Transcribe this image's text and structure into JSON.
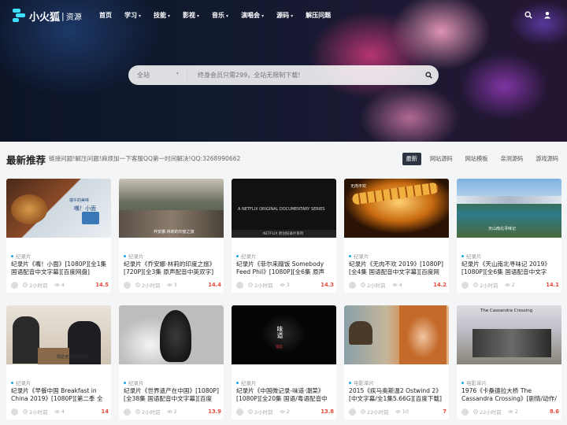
{
  "logo": {
    "name": "小火狐",
    "separator": "|",
    "sub": "资源"
  },
  "nav": [
    {
      "label": "首页",
      "dropdown": false
    },
    {
      "label": "学习",
      "dropdown": true
    },
    {
      "label": "技能",
      "dropdown": true
    },
    {
      "label": "影视",
      "dropdown": true
    },
    {
      "label": "音乐",
      "dropdown": true
    },
    {
      "label": "演唱会",
      "dropdown": true
    },
    {
      "label": "源码",
      "dropdown": true
    },
    {
      "label": "解压问题",
      "dropdown": false
    }
  ],
  "search": {
    "category": "全站",
    "placeholder": "终身会员只需299，全站无限制下载!"
  },
  "section": {
    "title": "最新推荐",
    "desc": "链接问题!解压问题!麻烦加一下客服QQ第一时间解决!QQ:3268990662"
  },
  "tabs": [
    "最新",
    "网站源码",
    "网站模板",
    "亲测源码",
    "游戏源码"
  ],
  "colors": {
    "accent": "#2c3442",
    "score": "#e84a3c",
    "cat_dot": "#1aa8e0"
  },
  "cards": [
    {
      "cat": "纪录片",
      "title": "纪录片《嘴！小面》[1080P][全1集 国语配音中文字幕][百度网盘]",
      "time": "2小时前",
      "views": "4",
      "score": "14.5",
      "overlay": [
        "端午的美味",
        "嘴！小面"
      ]
    },
    {
      "cat": "纪录片",
      "title": "纪录片《乔安娜·林莉的印度之旅》[720P][全3集 原声配音中英双字][...",
      "time": "2小时前",
      "views": "3",
      "score": "14.4",
      "overlay": [
        "乔安娜·林莉的印度之旅"
      ]
    },
    {
      "cat": "纪录片",
      "title": "纪录片《菲尔来蹭饭 Somebody Feed Phil》[1080P][全6集 原声配...",
      "time": "2小时前",
      "views": "3",
      "score": "14.3",
      "overlay": [
        "A NETFLIX ORIGINAL DOCUMENTARY SERIES",
        "NETFLIX 原创纪录片系列"
      ]
    },
    {
      "cat": "纪录片",
      "title": "纪录片《无肉不欢 2019》[1080P][全4集 国语配音中文字幕][百度网盘]",
      "time": "2小时前",
      "views": "4",
      "score": "14.2",
      "overlay": [
        "无肉不欢"
      ]
    },
    {
      "cat": "纪录片",
      "title": "纪录片《天山南北寻味记 2019》[1080P][全6集 国语配音中文字幕]...",
      "time": "2小时前",
      "views": "2",
      "score": "14.1",
      "overlay": [
        "天山南北寻味记"
      ]
    },
    {
      "cat": "纪录片",
      "title": "纪录片《早餐中国 Breakfast in China 2019》[1080P][第二季 全35...",
      "time": "2小时前",
      "views": "4",
      "score": "14",
      "overlay": [
        "隔壁老张的胡辣汤"
      ]
    },
    {
      "cat": "纪录片",
      "title": "纪录片《世界遗产在中国》[1080P][全38集 国语配音中文字幕][百度网...",
      "time": "2小时前",
      "views": "2",
      "score": "13.9",
      "overlay": []
    },
    {
      "cat": "纪录片",
      "title": "纪录片《中国微记录-味道·潮菜》[1080P][全20集 国语/粤语配音中文...",
      "time": "2小时前",
      "views": "2",
      "score": "13.8",
      "overlay": [
        "味道",
        "潮菜"
      ]
    },
    {
      "cat": "电影单片",
      "title": "2015《疾马奥斯温2 Ostwind 2》[中文字幕/全1集5.66G][百度下载]",
      "time": "22小时前",
      "views": "10",
      "score": "7",
      "overlay": []
    },
    {
      "cat": "电影单片",
      "title": "1976《卡桑德拉大桥 The Cassandra Crossing》[剧情/动作/惊悚/灾难][...",
      "time": "22小时前",
      "views": "2",
      "score": "8.6",
      "overlay": [
        "The Cassandra Crossing"
      ]
    }
  ]
}
